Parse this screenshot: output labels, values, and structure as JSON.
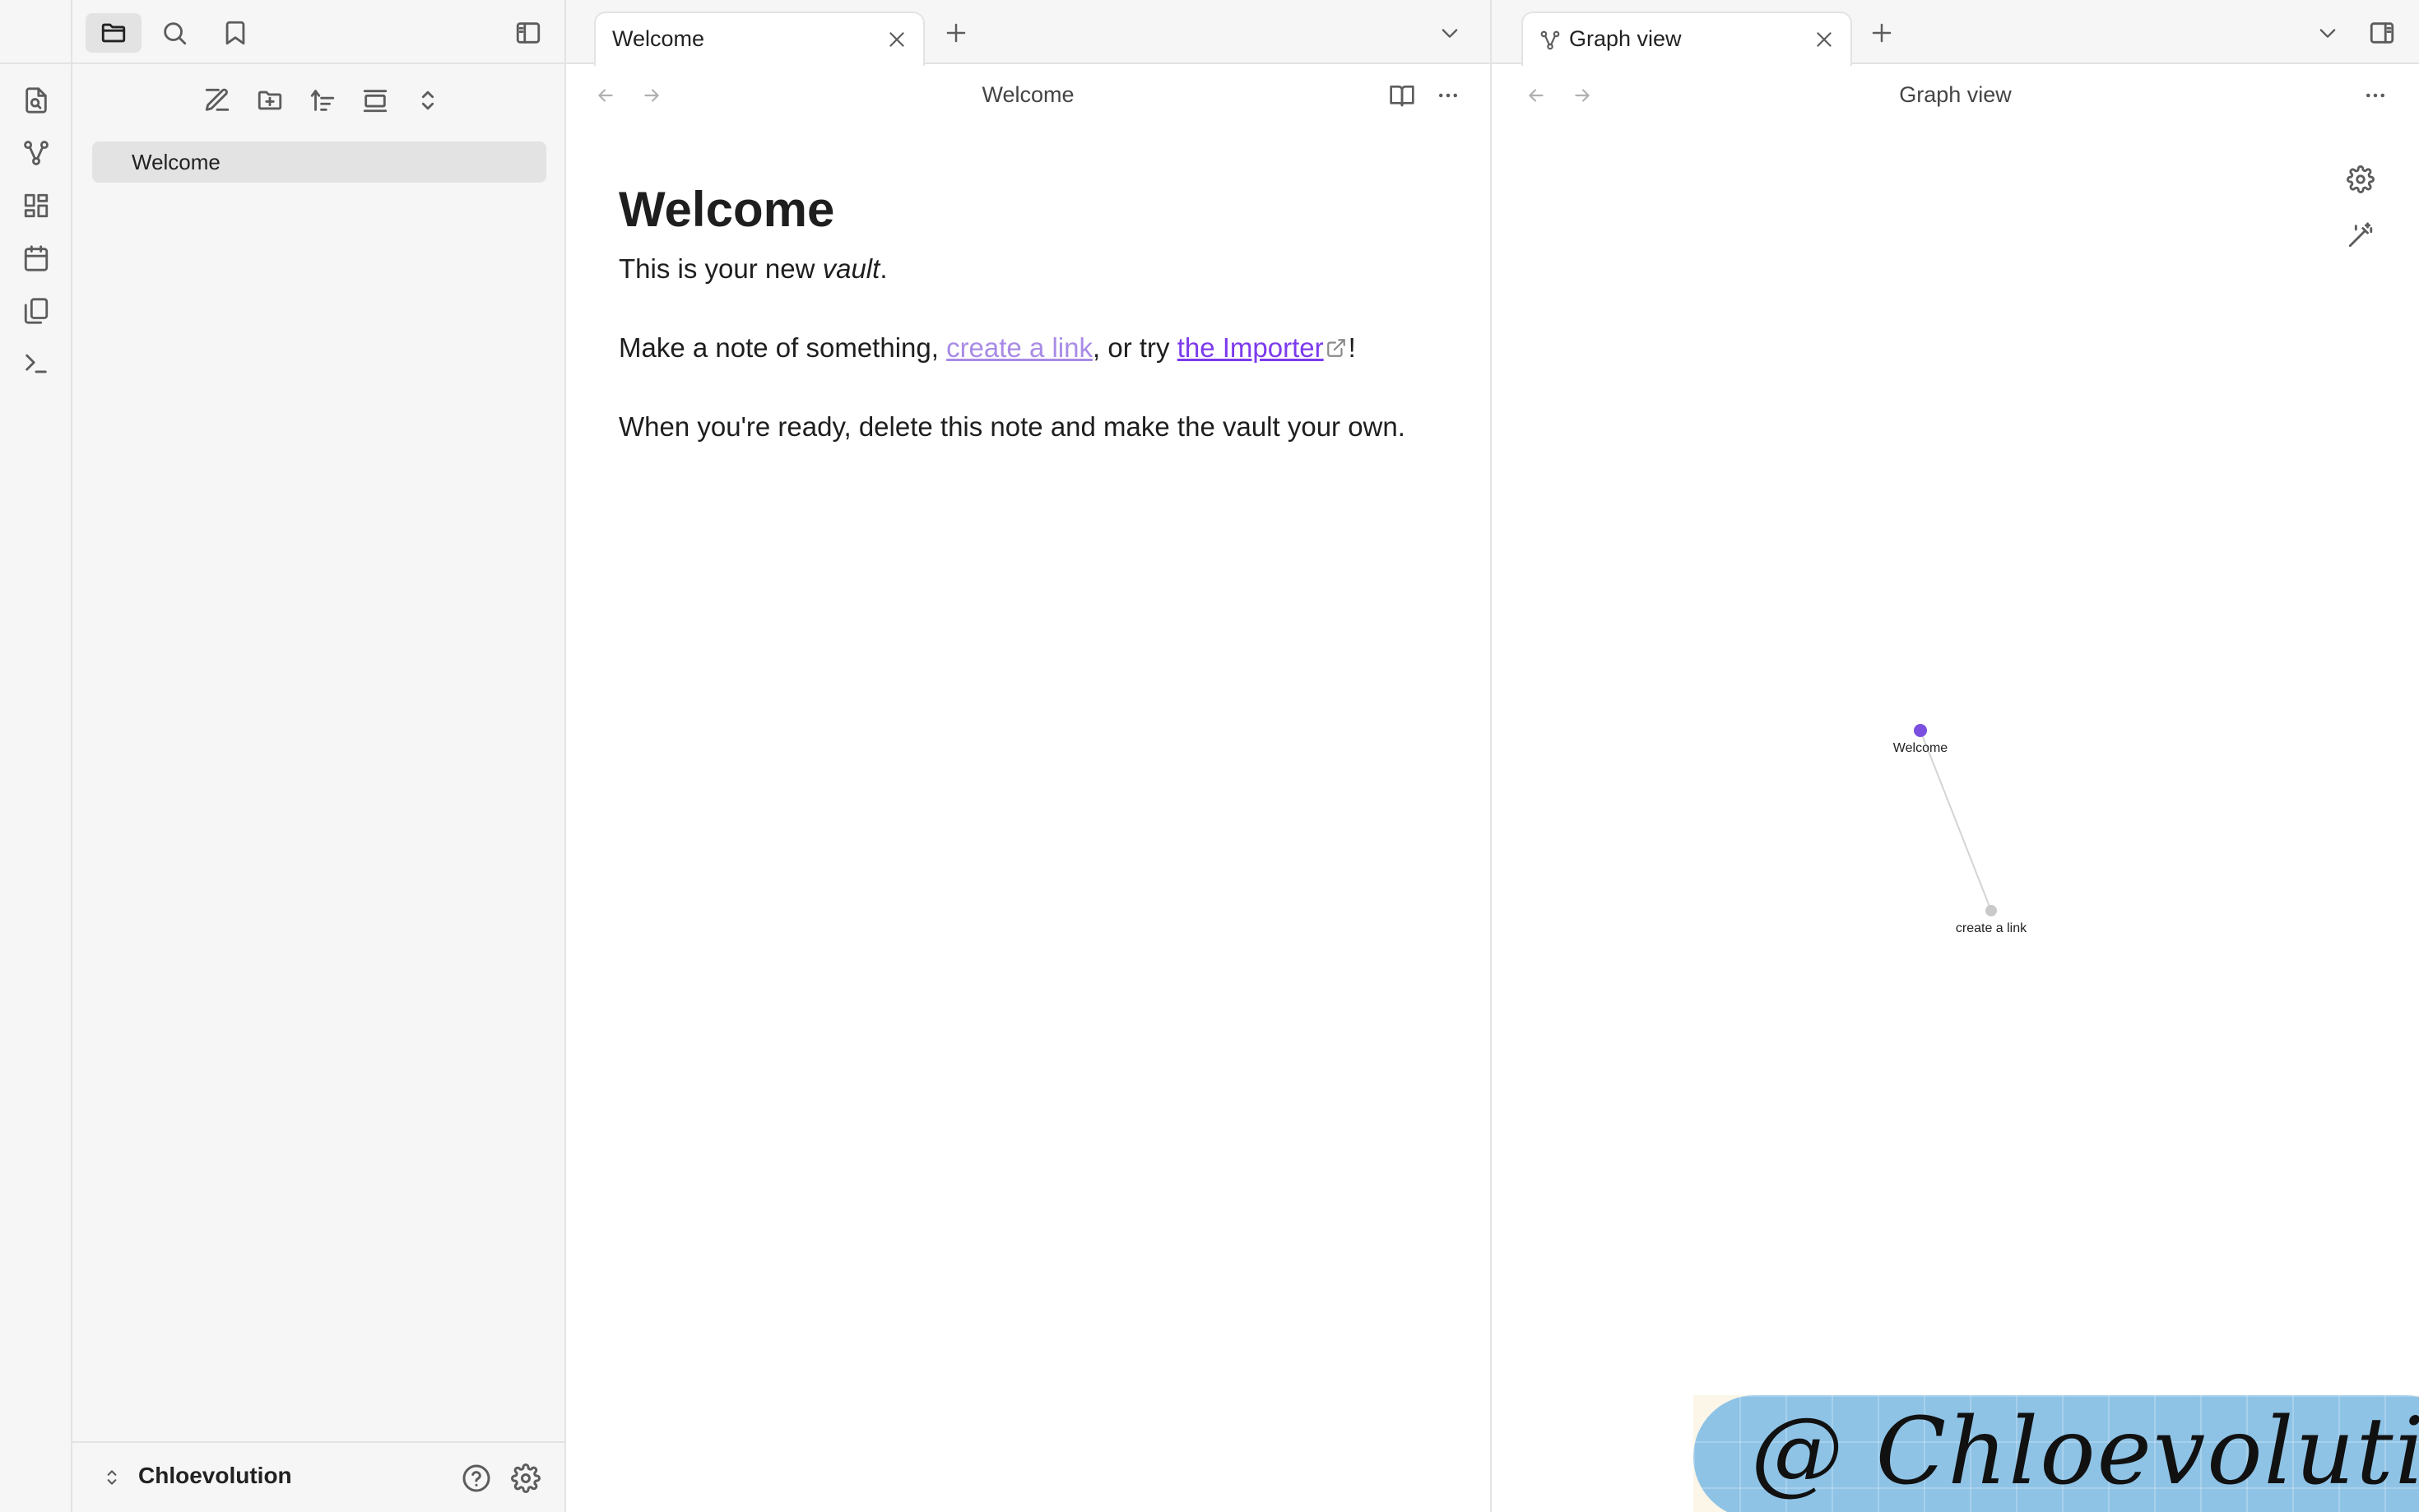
{
  "sidebar": {
    "files": [
      {
        "name": "Welcome"
      }
    ],
    "vault_name": "Chloevolution"
  },
  "editor": {
    "tab_title": "Welcome",
    "view_title": "Welcome",
    "doc": {
      "heading": "Welcome",
      "p1_before": "This is your new ",
      "p1_italic": "vault",
      "p1_after": ".",
      "p2_before": "Make a note of something, ",
      "p2_link_internal": "create a link",
      "p2_middle": ", or try ",
      "p2_link_external": "the Importer",
      "p2_after": "!",
      "p3": "When you're ready, delete this note and make the vault your own."
    }
  },
  "graph": {
    "tab_title": "Graph view",
    "view_title": "Graph view",
    "nodes": [
      {
        "label": "Welcome",
        "color": "#7b4fe0"
      },
      {
        "label": "create a link",
        "color": "#c9c9c9"
      }
    ]
  },
  "colors": {
    "accent": "#7c3aed",
    "internal_link": "#a88be6",
    "background_secondary": "#f6f6f6",
    "border": "#e3e3e3"
  },
  "watermark": {
    "text": "@ Chloevolution"
  }
}
